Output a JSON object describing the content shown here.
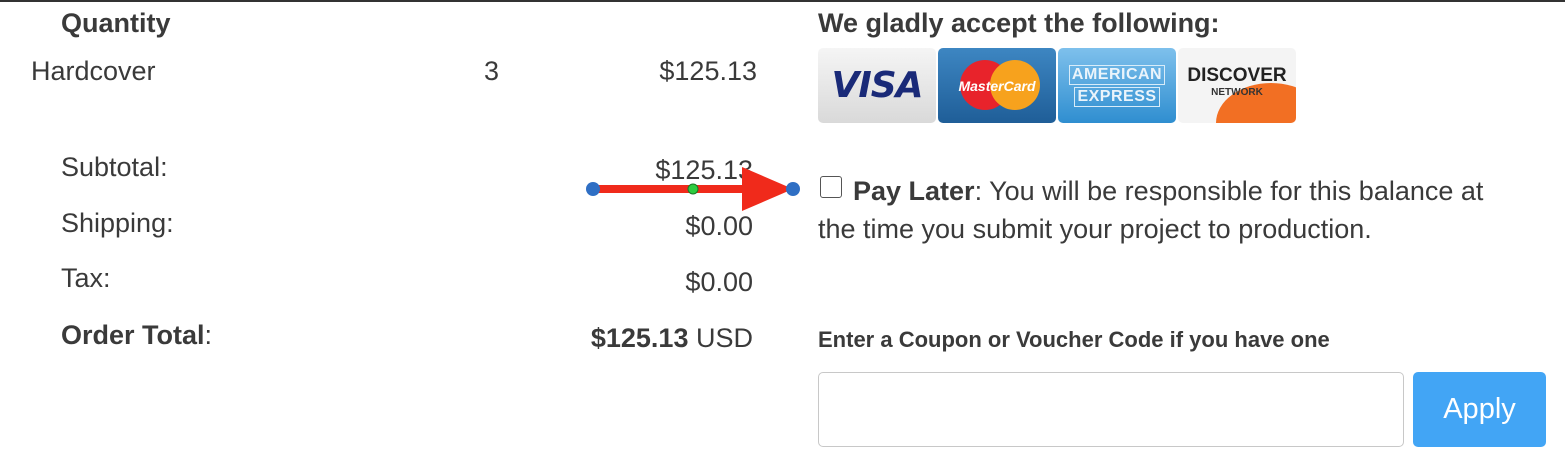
{
  "order": {
    "quantity_header": "Quantity",
    "item": {
      "name": "Hardcover",
      "quantity": "3",
      "price": "$125.13"
    },
    "summary": {
      "subtotal_label": "Subtotal:",
      "subtotal_value": "$125.13",
      "shipping_label": "Shipping:",
      "shipping_value": "$0.00",
      "tax_label": "Tax:",
      "tax_value": "$0.00",
      "total_label_bold": "Order Total",
      "total_label_colon": ":",
      "total_amount": "$125.13",
      "total_currency": "USD"
    }
  },
  "payment": {
    "accept_heading": "We gladly accept the following:",
    "cards": {
      "visa": "VISA",
      "mastercard": "MasterCard",
      "amex_line1": "AMERICAN",
      "amex_line2": "EXPRESS",
      "discover_line1": "DISCOVER",
      "discover_line2": "NETWORK"
    },
    "pay_later": {
      "checked": false,
      "label": "Pay Later",
      "description": ": You will be responsible for this balance at the time you submit your project to production."
    },
    "coupon": {
      "heading": "Enter a Coupon or Voucher Code if you have one",
      "value": "",
      "placeholder": "",
      "apply_label": "Apply"
    }
  },
  "colors": {
    "apply_button": "#42a5f5",
    "arrow": "#f02a1b",
    "handle": "#2f6fc4",
    "midpoint": "#2ecc40"
  }
}
